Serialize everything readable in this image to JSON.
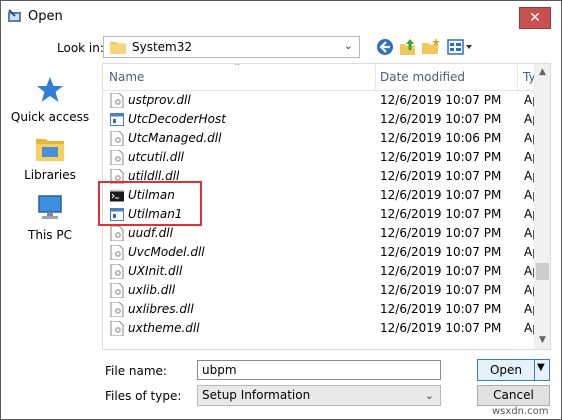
{
  "window": {
    "title": "Open",
    "close_glyph": "✕"
  },
  "lookin": {
    "label": "Look in:",
    "value": "System32"
  },
  "toolbar": {
    "icons": [
      "back-arrow-icon",
      "up-folder-icon",
      "new-folder-icon",
      "view-menu-icon"
    ]
  },
  "places": [
    {
      "label": "Quick access",
      "icon": "star-icon"
    },
    {
      "label": "Libraries",
      "icon": "libraries-icon"
    },
    {
      "label": "This PC",
      "icon": "computer-icon"
    }
  ],
  "columns": {
    "name": "Name",
    "date": "Date modified",
    "type": "Ty"
  },
  "files": [
    {
      "name": "ustprov.dll",
      "date": "12/6/2019 10:07 PM",
      "type": "Ap",
      "icon": "dll"
    },
    {
      "name": "UtcDecoderHost",
      "date": "12/6/2019 10:07 PM",
      "type": "Ap",
      "icon": "app"
    },
    {
      "name": "UtcManaged.dll",
      "date": "12/6/2019 10:06 PM",
      "type": "Ap",
      "icon": "dll"
    },
    {
      "name": "utcutil.dll",
      "date": "12/6/2019 10:07 PM",
      "type": "Ap",
      "icon": "dll"
    },
    {
      "name": "utildll.dll",
      "date": "12/6/2019 10:07 PM",
      "type": "Ap",
      "icon": "dll"
    },
    {
      "name": "Utilman",
      "date": "12/6/2019 10:07 PM",
      "type": "Ap",
      "icon": "console"
    },
    {
      "name": "Utilman1",
      "date": "12/6/2019 10:07 PM",
      "type": "Ap",
      "icon": "app"
    },
    {
      "name": "uudf.dll",
      "date": "12/6/2019 10:07 PM",
      "type": "Ap",
      "icon": "dll"
    },
    {
      "name": "UvcModel.dll",
      "date": "12/6/2019 10:07 PM",
      "type": "Ap",
      "icon": "dll"
    },
    {
      "name": "UXInit.dll",
      "date": "12/6/2019 10:07 PM",
      "type": "Ap",
      "icon": "dll"
    },
    {
      "name": "uxlib.dll",
      "date": "12/6/2019 10:07 PM",
      "type": "Ap",
      "icon": "dll"
    },
    {
      "name": "uxlibres.dll",
      "date": "12/6/2019 10:07 PM",
      "type": "Ap",
      "icon": "dll"
    },
    {
      "name": "uxtheme.dll",
      "date": "12/6/2019 10:07 PM",
      "type": "Ap",
      "icon": "dll"
    }
  ],
  "filename": {
    "label": "File name:",
    "value": "ubpm"
  },
  "filetype": {
    "label": "Files of type:",
    "value": "Setup Information"
  },
  "buttons": {
    "open": "Open",
    "cancel": "Cancel"
  },
  "watermark": "wsxdn.com",
  "colors": {
    "highlight_box": "#e03030",
    "close_button": "#c75050",
    "header_text": "#4c607a"
  }
}
